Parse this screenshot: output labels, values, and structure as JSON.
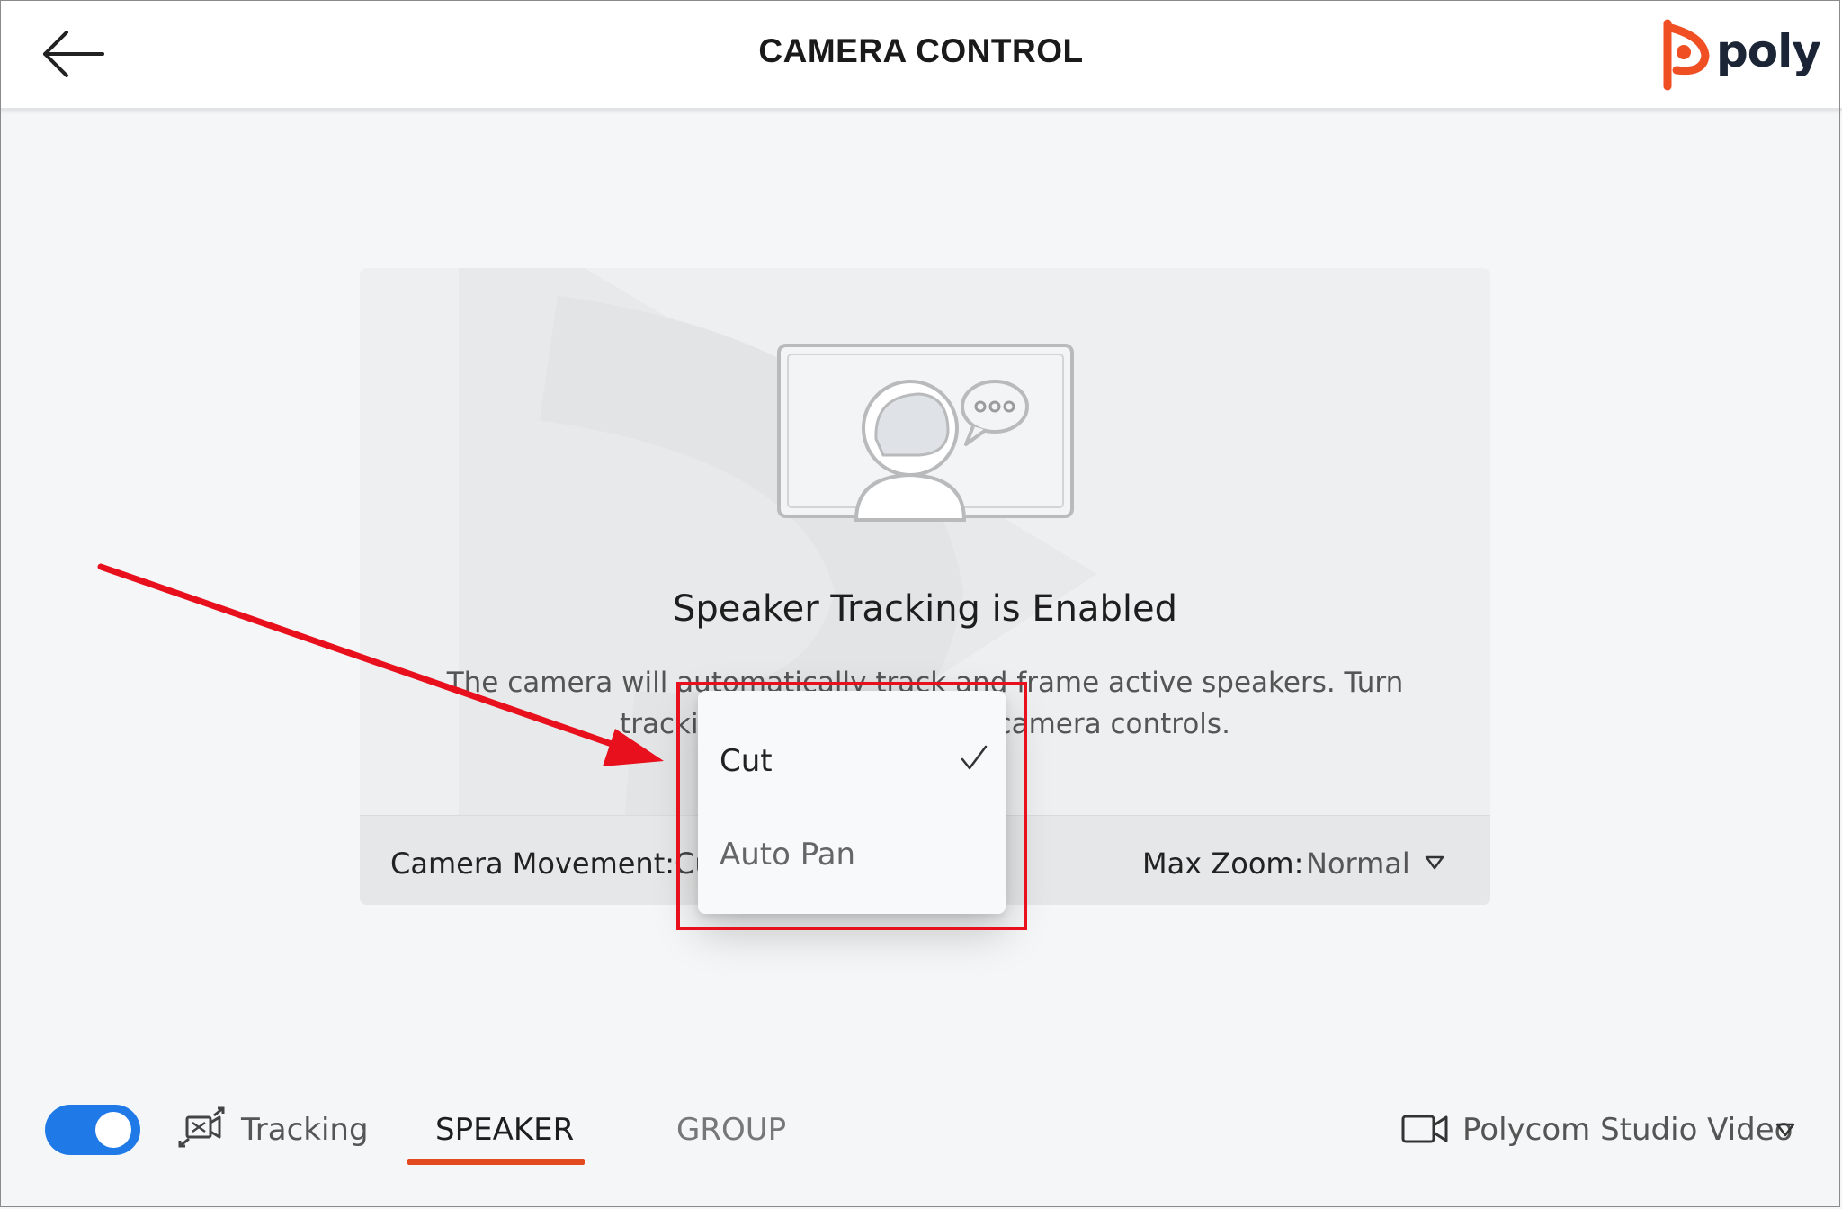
{
  "header": {
    "title": "CAMERA CONTROL",
    "back_icon": "arrow-left-icon",
    "logo_text": "poly"
  },
  "status": {
    "title": "Speaker Tracking is Enabled",
    "description": "The camera will automatically track and frame active speakers. Turn tracking off to use manual camera controls."
  },
  "settings": {
    "camera_movement_label": "Camera Movement:",
    "camera_movement_value": "Cut",
    "max_zoom_label": "Max Zoom:",
    "max_zoom_value": "Normal"
  },
  "dropdown": {
    "options": [
      {
        "label": "Cut",
        "selected": true
      },
      {
        "label": "Auto Pan",
        "selected": false
      }
    ]
  },
  "bottom_bar": {
    "tracking_toggle_on": true,
    "tracking_label": "Tracking",
    "tabs": [
      {
        "label": "SPEAKER",
        "active": true
      },
      {
        "label": "GROUP",
        "active": false
      }
    ],
    "device_label": "Polycom Studio Video"
  },
  "colors": {
    "accent_blue": "#1f7ae8",
    "tab_underline": "#e34a1f",
    "annotation_red": "#e8101d",
    "logo_orange": "#f04e23",
    "logo_navy": "#1b2536"
  }
}
